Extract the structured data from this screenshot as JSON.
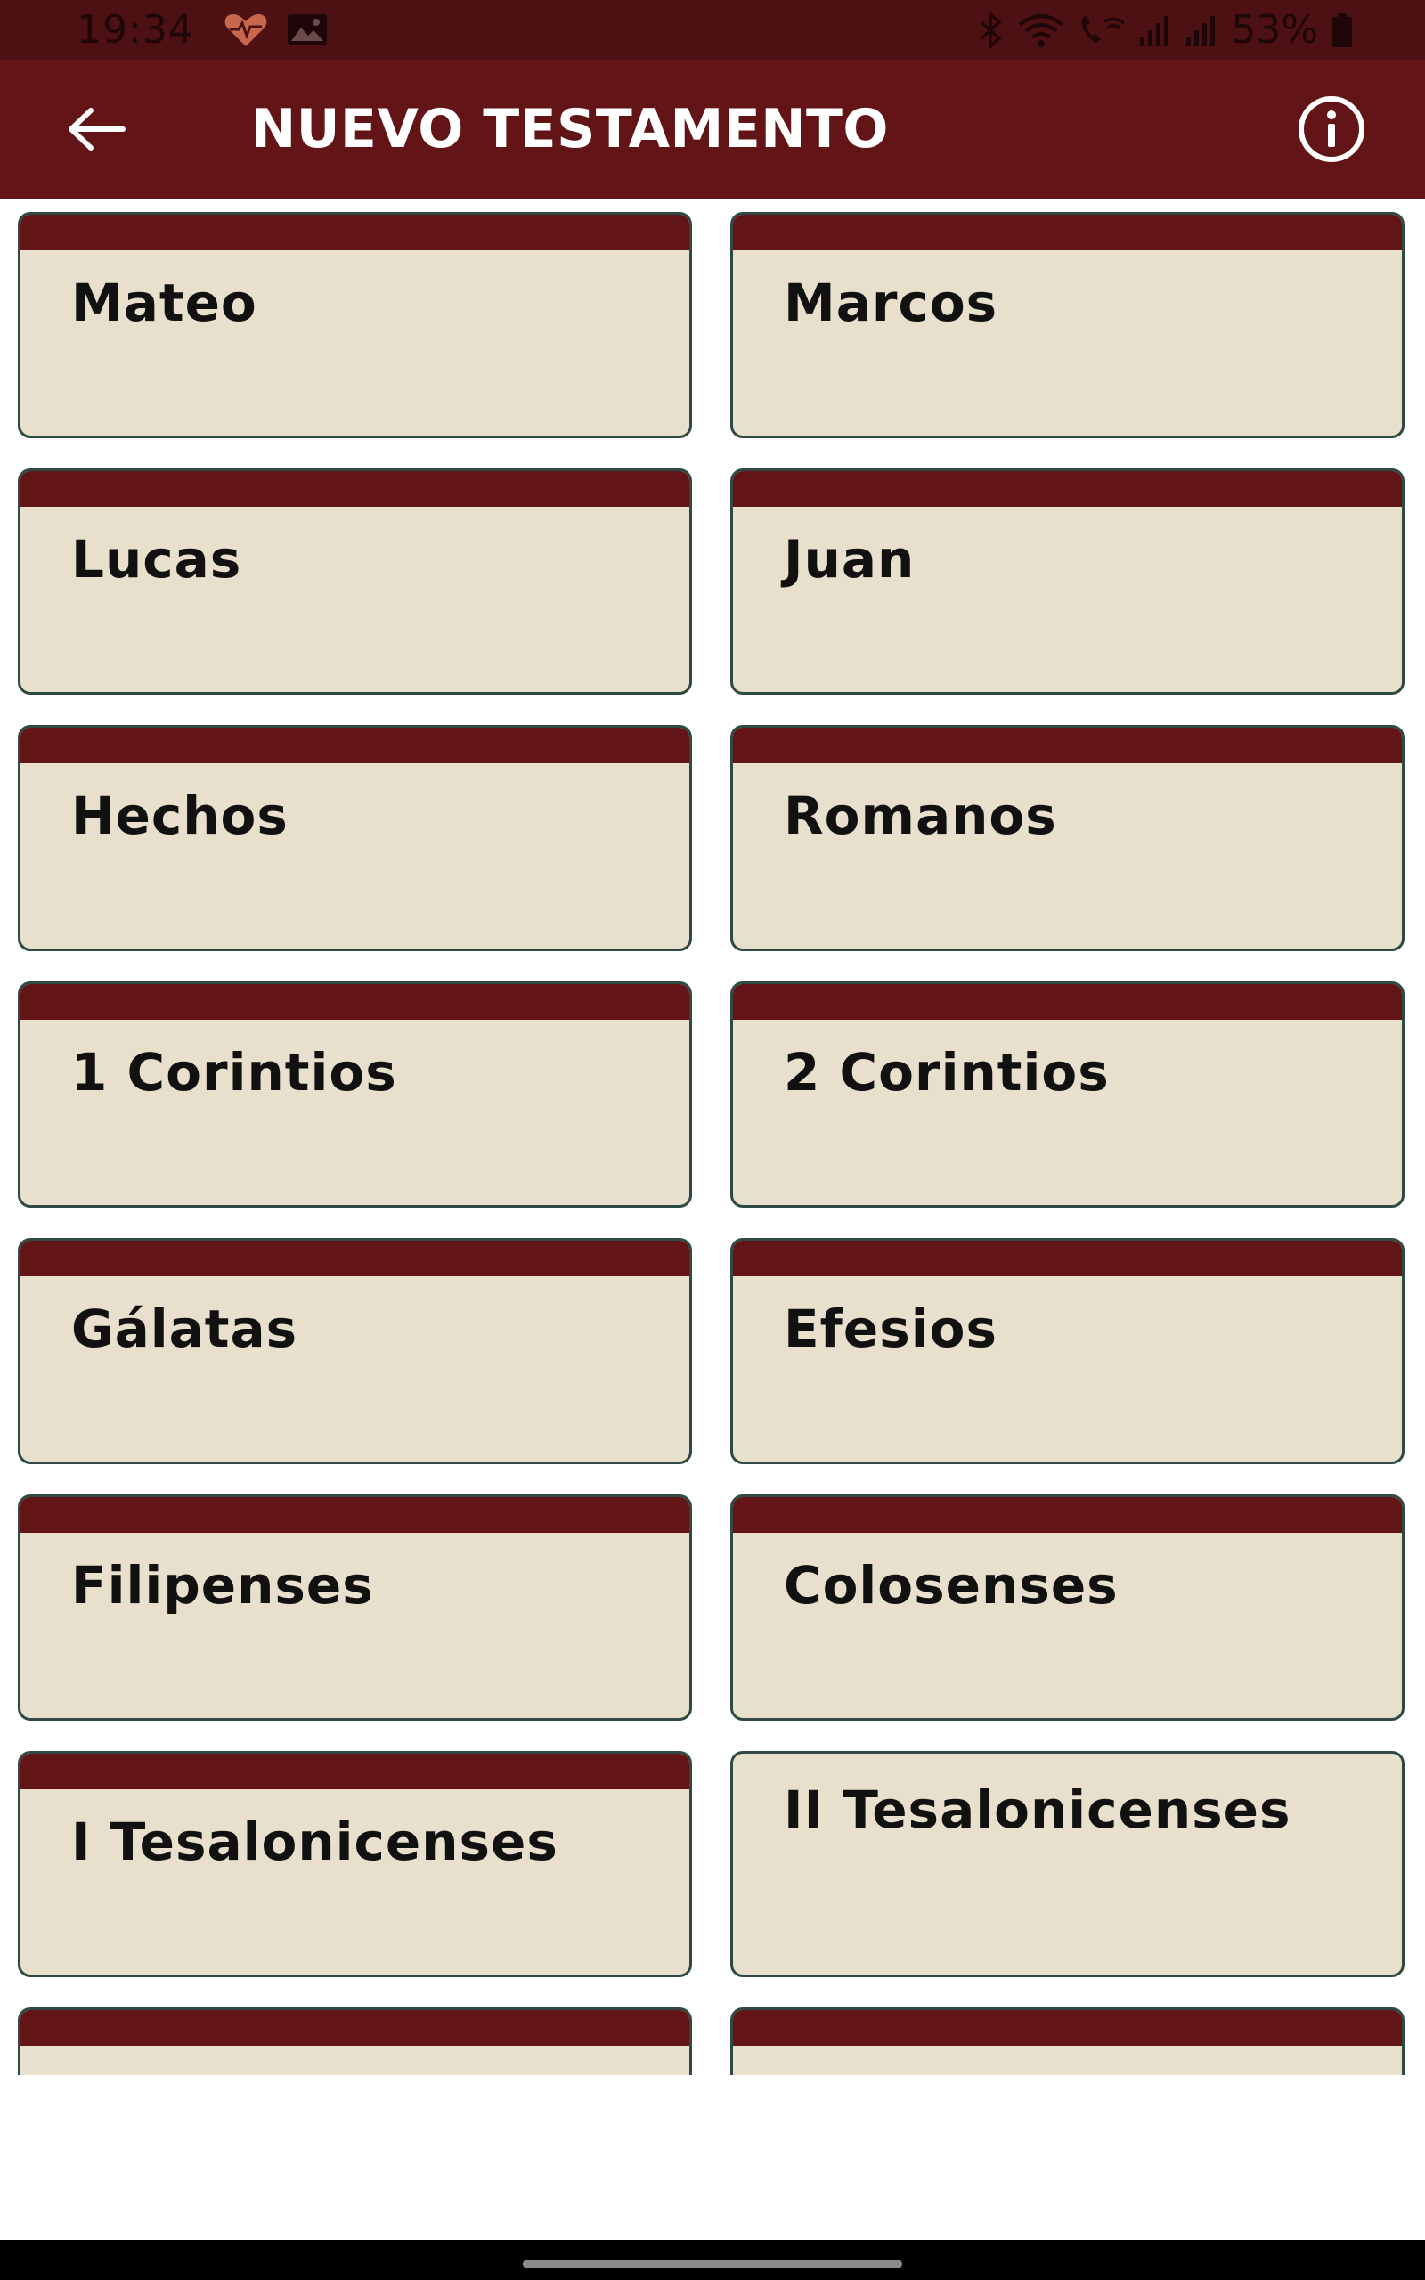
{
  "status_bar": {
    "time": "19:34",
    "battery": "53%",
    "icons": [
      "heart-monitor-icon",
      "gallery-icon",
      "bluetooth-icon",
      "wifi-icon",
      "wifi-calling-icon",
      "signal-icon",
      "signal-icon",
      "battery-icon"
    ]
  },
  "app_bar": {
    "title": "NUEVO TESTAMENTO",
    "back_icon": "arrow-left-icon",
    "info_icon": "info-circle-icon",
    "color": "#631416"
  },
  "colors": {
    "card_background": "#e8e0cc",
    "card_band": "#631416",
    "card_border": "#2f4a44",
    "status_bar": "#4d1114"
  },
  "books": [
    "Mateo",
    "Marcos",
    "Lucas",
    "Juan",
    "Hechos",
    "Romanos",
    "1 Corintios",
    "2 Corintios",
    "Gálatas",
    "Efesios",
    "Filipenses",
    "Colosenses",
    "I Tesalonicenses",
    "II Tesalonicenses",
    "",
    ""
  ]
}
